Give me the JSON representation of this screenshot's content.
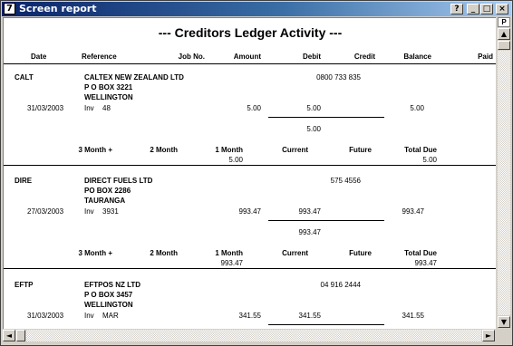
{
  "window": {
    "title": "Screen report",
    "help": "?",
    "minimize": "_",
    "maximize": "□",
    "close": "×"
  },
  "report": {
    "title": "---  Creditors Ledger Activity  ---",
    "columns": {
      "date": "Date",
      "reference": "Reference",
      "job": "Job No.",
      "amount": "Amount",
      "debit": "Debit",
      "credit": "Credit",
      "balance": "Balance",
      "paid": "Paid"
    },
    "aging_headers": {
      "m3": "3 Month +",
      "m2": "2 Month",
      "m1": "1 Month",
      "current": "Current",
      "future": "Future",
      "total": "Total Due"
    },
    "creditors": [
      {
        "code": "CALT",
        "name": "CALTEX NEW ZEALAND LTD",
        "addr1": "P O BOX 3221",
        "addr2": "WELLINGTON",
        "phone": "0800 733 835",
        "date": "31/03/2003",
        "type": "Inv",
        "ref": "48",
        "amount": "5.00",
        "debit": "5.00",
        "balance": "5.00",
        "debit_total": "5.00",
        "aging_m1": "5.00",
        "aging_total": "5.00"
      },
      {
        "code": "DIRE",
        "name": "DIRECT FUELS LTD",
        "addr1": "PO BOX 2286",
        "addr2": "TAURANGA",
        "phone": "575 4556",
        "date": "27/03/2003",
        "type": "Inv",
        "ref": "3931",
        "amount": "993.47",
        "debit": "993.47",
        "balance": "993.47",
        "debit_total": "993.47",
        "aging_m1": "993.47",
        "aging_total": "993.47"
      },
      {
        "code": "EFTP",
        "name": "EFTPOS NZ LTD",
        "addr1": "P O BOX 3457",
        "addr2": "WELLINGTON",
        "phone": "04 916 2444",
        "date": "31/03/2003",
        "type": "Inv",
        "ref": "MAR",
        "amount": "341.55",
        "debit": "341.55",
        "balance": "341.55"
      }
    ]
  },
  "scrollbar": {
    "page_marker": "P",
    "up": "▲",
    "down": "▼",
    "left": "◄",
    "right": "►"
  }
}
